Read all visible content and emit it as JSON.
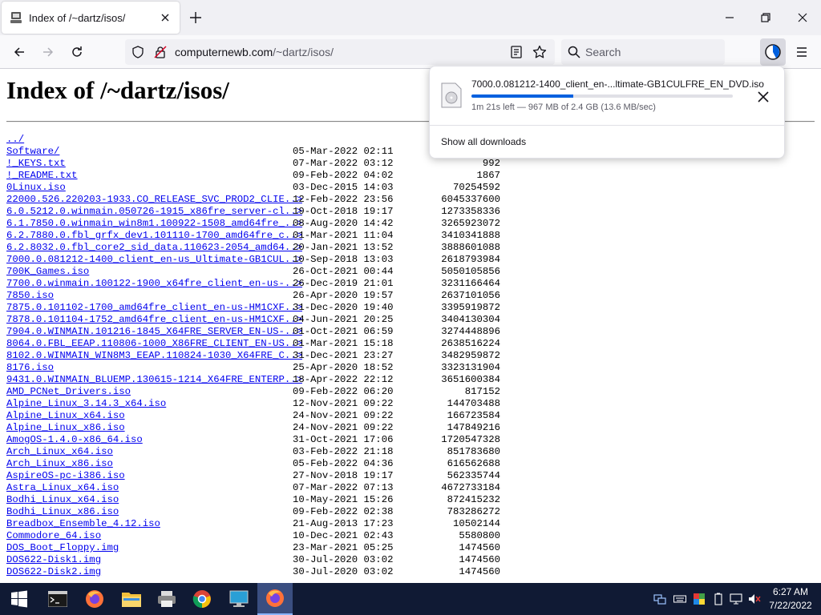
{
  "browser": {
    "tab_title": "Index of /~dartz/isos/",
    "url_domain": "computernewb.com",
    "url_path": "/~dartz/isos/",
    "search_placeholder": "Search"
  },
  "page": {
    "heading": "Index of /~dartz/isos/",
    "entries": [
      {
        "name": "../",
        "date": "",
        "size": ""
      },
      {
        "name": "Software/",
        "date": "05-Mar-2022 02:11",
        "size": "-"
      },
      {
        "name": "!_KEYS.txt",
        "date": "07-Mar-2022 03:12",
        "size": "992"
      },
      {
        "name": "!_README.txt",
        "date": "09-Feb-2022 04:02",
        "size": "1867"
      },
      {
        "name": "0Linux.iso",
        "date": "03-Dec-2015 14:03",
        "size": "70254592"
      },
      {
        "name": "22000.526.220203-1933.CO_RELEASE_SVC_PROD2_CLIE..>",
        "date": "12-Feb-2022 23:56",
        "size": "6045337600"
      },
      {
        "name": "6.0.5212.0.winmain.050726-1915_x86fre_server-cl..>",
        "date": "19-Oct-2018 19:17",
        "size": "1273358336"
      },
      {
        "name": "6.1.7850.0.winmain_win8m1.100922-1508_amd64fre_..>",
        "date": "08-Aug-2020 14:42",
        "size": "3265923072"
      },
      {
        "name": "6.2.7880.0.fbl_grfx_dev1.101110-1700_amd64fre_c..>",
        "date": "01-Mar-2021 11:04",
        "size": "3410341888"
      },
      {
        "name": "6.2.8032.0.fbl_core2_sid_data.110623-2054_amd64..>",
        "date": "20-Jan-2021 13:52",
        "size": "3888601088"
      },
      {
        "name": "7000.0.081212-1400_client_en-us_Ultimate-GB1CUL..>",
        "date": "10-Sep-2018 13:03",
        "size": "2618793984"
      },
      {
        "name": "700K_Games.iso",
        "date": "26-Oct-2021 00:44",
        "size": "5050105856"
      },
      {
        "name": "7700.0.winmain.100122-1900_x64fre_client_en-us-..>",
        "date": "26-Dec-2019 21:01",
        "size": "3231166464"
      },
      {
        "name": "7850.iso",
        "date": "26-Apr-2020 19:57",
        "size": "2637101056"
      },
      {
        "name": "7875.0.101102-1700_amd64fre_client_en-us-HM1CXF..>",
        "date": "31-Dec-2020 19:40",
        "size": "3395919872"
      },
      {
        "name": "7878.0.101104-1752_amd64fre_client_en-us-HM1CXF..>",
        "date": "04-Jun-2021 20:25",
        "size": "3404130304"
      },
      {
        "name": "7904.0.WINMAIN.101216-1845_X64FRE_SERVER_EN-US-..>",
        "date": "01-Oct-2021 06:59",
        "size": "3274448896"
      },
      {
        "name": "8064.0.FBL_EEAP.110806-1000_X86FRE_CLIENT_EN-US..>",
        "date": "01-Mar-2021 15:18",
        "size": "2638516224"
      },
      {
        "name": "8102.0.WINMAIN_WIN8M3_EEAP.110824-1030_X64FRE_C..>",
        "date": "31-Dec-2021 23:27",
        "size": "3482959872"
      },
      {
        "name": "8176.iso",
        "date": "25-Apr-2020 18:52",
        "size": "3323131904"
      },
      {
        "name": "9431.0.WINMAIN_BLUEMP.130615-1214_X64FRE_ENTERP..>",
        "date": "18-Apr-2022 22:12",
        "size": "3651600384"
      },
      {
        "name": "AMD_PCNet_Drivers.iso",
        "date": "09-Feb-2022 06:20",
        "size": "817152"
      },
      {
        "name": "Alpine_Linux_3.14.3_x64.iso",
        "date": "12-Nov-2021 09:22",
        "size": "144703488"
      },
      {
        "name": "Alpine_Linux_x64.iso",
        "date": "24-Nov-2021 09:22",
        "size": "166723584"
      },
      {
        "name": "Alpine_Linux_x86.iso",
        "date": "24-Nov-2021 09:22",
        "size": "147849216"
      },
      {
        "name": "AmogOS-1.4.0-x86_64.iso",
        "date": "31-Oct-2021 17:06",
        "size": "1720547328"
      },
      {
        "name": "Arch_Linux_x64.iso",
        "date": "03-Feb-2022 21:18",
        "size": "851783680"
      },
      {
        "name": "Arch_Linux_x86.iso",
        "date": "05-Feb-2022 04:36",
        "size": "616562688"
      },
      {
        "name": "AspireOS-pc-i386.iso",
        "date": "27-Nov-2018 19:17",
        "size": "562335744"
      },
      {
        "name": "Astra_Linux_x64.iso",
        "date": "07-Mar-2022 07:13",
        "size": "4672733184"
      },
      {
        "name": "Bodhi_Linux_x64.iso",
        "date": "10-May-2021 15:26",
        "size": "872415232"
      },
      {
        "name": "Bodhi_Linux_x86.iso",
        "date": "09-Feb-2022 02:38",
        "size": "783286272"
      },
      {
        "name": "Breadbox_Ensemble_4.12.iso",
        "date": "21-Aug-2013 17:23",
        "size": "10502144"
      },
      {
        "name": "Commodore_64.iso",
        "date": "10-Dec-2021 02:43",
        "size": "5580800"
      },
      {
        "name": "DOS_Boot_Floppy.img",
        "date": "23-Mar-2021 05:25",
        "size": "1474560"
      },
      {
        "name": "DOS622-Disk1.img",
        "date": "30-Jul-2020 03:02",
        "size": "1474560"
      },
      {
        "name": "DOS622-Disk2.img",
        "date": "30-Jul-2020 03:02",
        "size": "1474560"
      }
    ]
  },
  "downloads": {
    "filename": "7000.0.081212-1400_client_en-...ltimate-GB1CULFRE_EN_DVD.iso",
    "status": "1m 21s left — 967 MB of 2.4 GB (13.6 MB/sec)",
    "progress": 0.39,
    "show_all_label": "Show all downloads",
    "accent_color": "#0060df"
  },
  "taskbar": {
    "time": "6:27 AM",
    "date": "7/22/2022",
    "icons": [
      "start-icon",
      "cmd-icon",
      "firefox-icon",
      "file-explorer-icon",
      "printer-icon",
      "chrome-icon",
      "monitor-icon",
      "firefox-active-icon"
    ]
  }
}
